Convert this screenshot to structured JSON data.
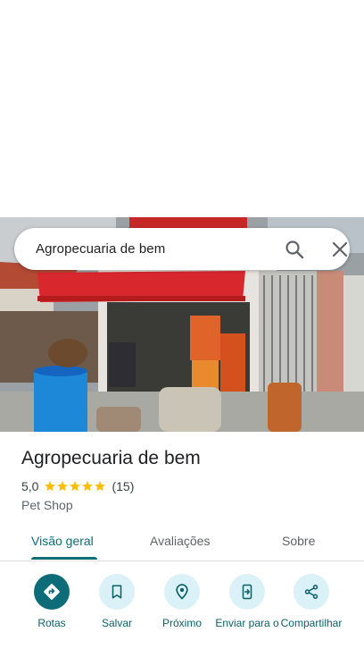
{
  "search": {
    "query": "Agropecuaria de bem"
  },
  "place": {
    "name": "Agropecuaria de bem",
    "rating": "5,0",
    "stars": 5,
    "review_count": "(15)",
    "category": "Pet Shop"
  },
  "tabs": [
    {
      "label": "Visão geral",
      "active": true
    },
    {
      "label": "Avaliações",
      "active": false
    },
    {
      "label": "Sobre",
      "active": false
    }
  ],
  "actions": [
    {
      "label": "Rotas",
      "icon": "directions-icon",
      "primary": true
    },
    {
      "label": "Salvar",
      "icon": "bookmark-icon",
      "primary": false
    },
    {
      "label": "Próximo",
      "icon": "nearby-icon",
      "primary": false
    },
    {
      "label": "Enviar para o",
      "icon": "send-to-phone-icon",
      "primary": false
    },
    {
      "label": "Compartilhar",
      "icon": "share-icon",
      "primary": false
    }
  ],
  "colors": {
    "accent": "#0b6e78",
    "action_bg": "#d9f1f7",
    "primary_action_bg": "#0e6c79",
    "star": "#fbbc04"
  }
}
